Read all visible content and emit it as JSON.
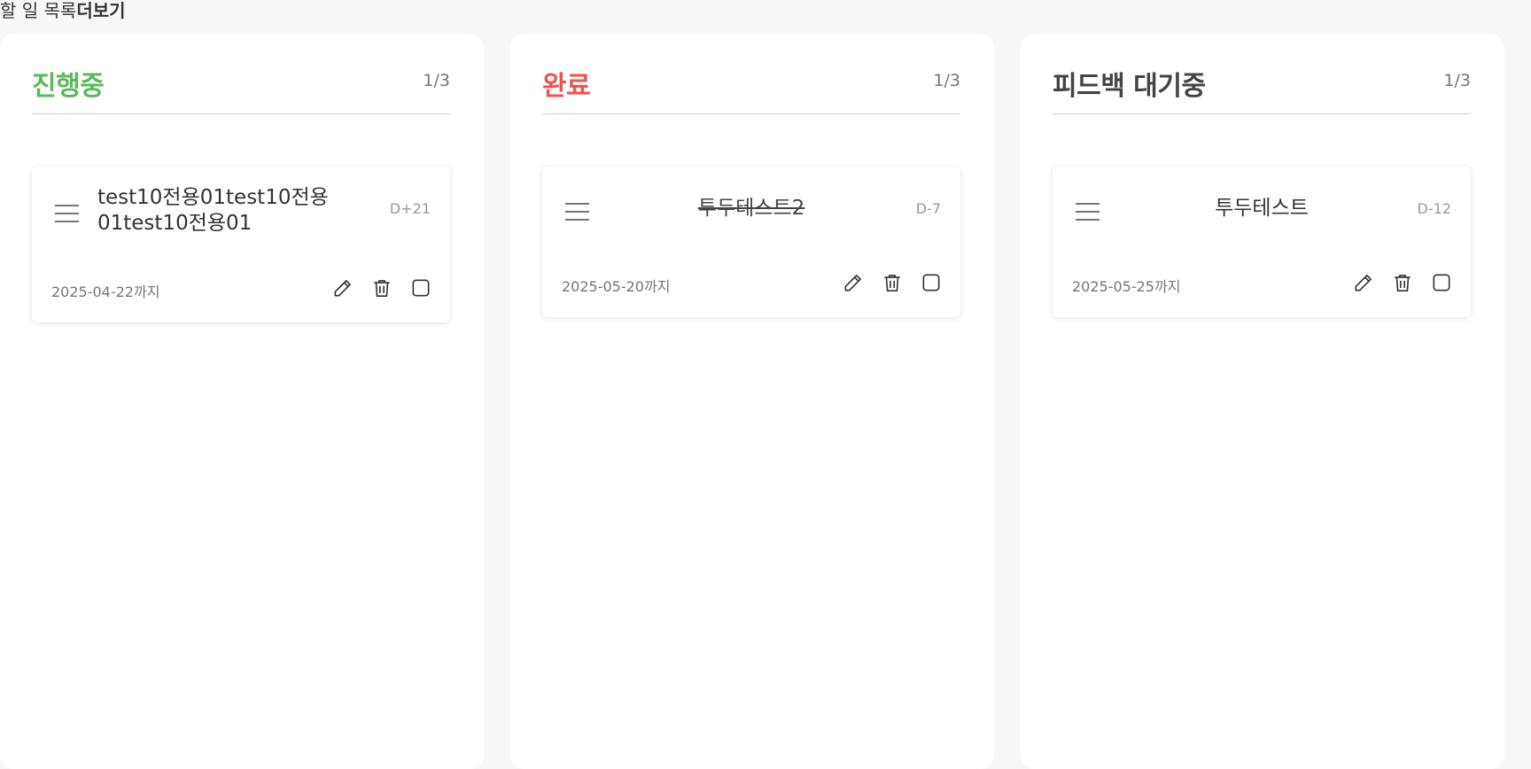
{
  "header": {
    "title": "할 일 목록",
    "more_label": "더보기"
  },
  "colors": {
    "in_progress": "#5cb85c",
    "done": "#f0544f",
    "waiting": "#444444"
  },
  "columns": [
    {
      "title": "진행중",
      "count": "1/3",
      "card": {
        "title": "test10전용01test10전용01test10전용01",
        "dday": "D+21",
        "due": "2025-04-22까지",
        "icons": [
          "menu-icon",
          "pencil-icon",
          "trash-icon",
          "checkbox-icon"
        ]
      }
    },
    {
      "title": "완료",
      "count": "1/3",
      "card": {
        "title": "투두테스트2",
        "dday": "D-7",
        "due": "2025-05-20까지",
        "icons": [
          "menu-icon",
          "pencil-icon",
          "trash-icon",
          "checkbox-icon"
        ]
      }
    },
    {
      "title": "피드백 대기중",
      "count": "1/3",
      "card": {
        "title": "투두테스트",
        "dday": "D-12",
        "due": "2025-05-25까지",
        "icons": [
          "menu-icon",
          "pencil-icon",
          "trash-icon",
          "checkbox-icon"
        ]
      }
    }
  ]
}
